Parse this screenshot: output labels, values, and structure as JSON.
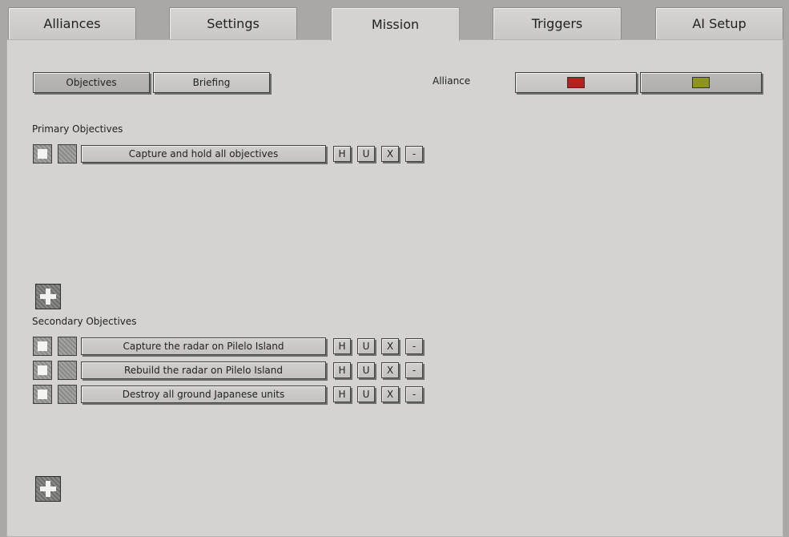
{
  "tabs": [
    {
      "label": "Alliances"
    },
    {
      "label": "Settings"
    },
    {
      "label": "Mission"
    },
    {
      "label": "Triggers"
    },
    {
      "label": "AI Setup"
    }
  ],
  "active_tab": "Mission",
  "subtabs": {
    "objectives": "Objectives",
    "briefing": "Briefing"
  },
  "alliance": {
    "label": "Alliance",
    "colors": [
      "#b3221e",
      "#8e9422"
    ]
  },
  "primary": {
    "title": "Primary Objectives",
    "items": [
      {
        "text": "Capture and hold all objectives"
      }
    ]
  },
  "secondary": {
    "title": "Secondary Objectives",
    "items": [
      {
        "text": "Capture the radar on Pilelo Island"
      },
      {
        "text": "Rebuild the radar on Pilelo Island"
      },
      {
        "text": "Destroy all ground Japanese units"
      }
    ]
  },
  "row_buttons": {
    "h": "H",
    "u": "U",
    "x": "X",
    "minus": "-"
  }
}
